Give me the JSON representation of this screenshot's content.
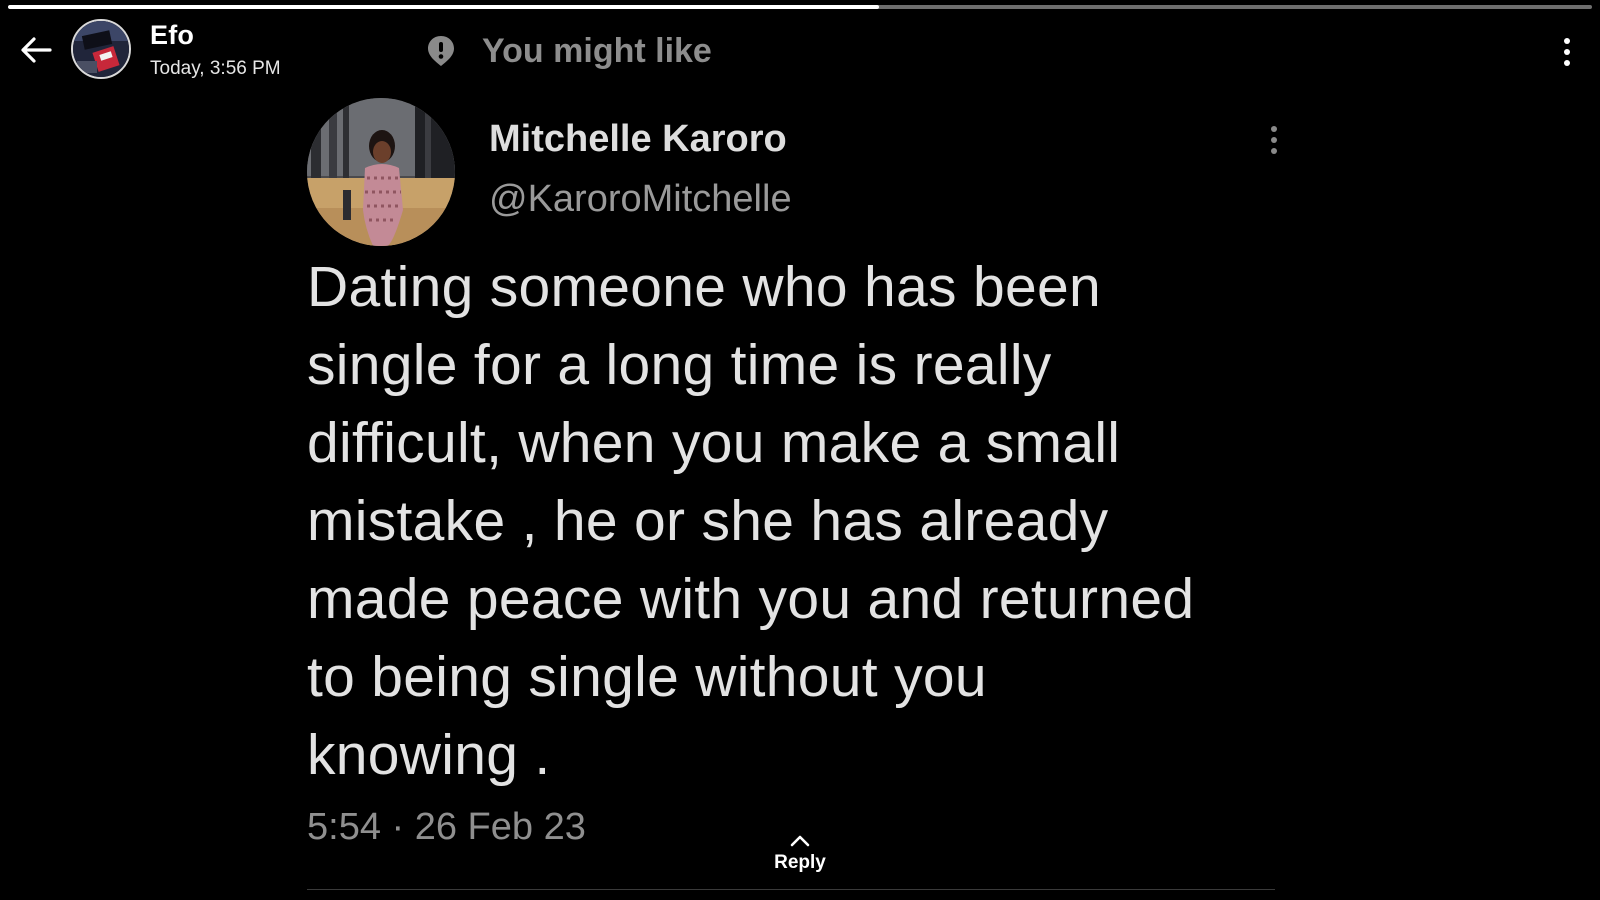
{
  "status": {
    "progress_fraction": 0.55
  },
  "header": {
    "poster_name": "Efo",
    "timestamp": "Today, 3:56 PM",
    "suggestion_label": "You might like",
    "back_icon": "back-arrow-icon",
    "menu_icon": "more-vertical-icon",
    "suggestion_icon": "map-pin-icon"
  },
  "tweet": {
    "author_name": "Mitchelle Karoro",
    "author_handle": "@KaroroMitchelle",
    "lines": [
      "Dating someone who has been",
      "single for a long time is really",
      "difficult, when you make a small",
      "mistake , he or she has already",
      "made peace with you and returned",
      "to being single without you",
      "knowing ."
    ],
    "meta": "5:54 · 26 Feb 23",
    "menu_icon": "more-vertical-icon"
  },
  "footer": {
    "reply_label": "Reply",
    "reply_icon": "chevron-up-icon"
  },
  "colors": {
    "background": "#000000",
    "progress_track": "#6e6e6e",
    "progress_fill": "#ffffff",
    "muted_text": "#8d8d8d"
  }
}
